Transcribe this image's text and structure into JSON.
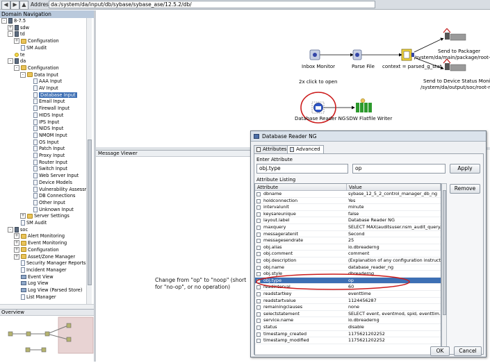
{
  "toolbar": {
    "back": "◀",
    "forward": "◀",
    "up": "▲",
    "address_label": "Address:",
    "address_value": "da:/system/da/input/db/sybase/sybase_ase/12.5.2/db/"
  },
  "domain_nav": {
    "header": "Domain Navigation",
    "items": [
      {
        "label": "8-7.5",
        "indent": 0,
        "tw": "-",
        "icon": "server"
      },
      {
        "label": "sdw",
        "indent": 1,
        "tw": "+",
        "icon": "server"
      },
      {
        "label": "td",
        "indent": 1,
        "tw": "-",
        "icon": "server"
      },
      {
        "label": "Configuration",
        "indent": 2,
        "tw": "+",
        "icon": "folder"
      },
      {
        "label": "SM Audit",
        "indent": 2,
        "tw": "",
        "icon": "doc"
      },
      {
        "label": "te",
        "indent": 1,
        "tw": "",
        "icon": "bulb"
      },
      {
        "label": "da",
        "indent": 1,
        "tw": "-",
        "icon": "server"
      },
      {
        "label": "Configuration",
        "indent": 2,
        "tw": "-",
        "icon": "folder"
      },
      {
        "label": "Data Input",
        "indent": 3,
        "tw": "-",
        "icon": "folder"
      },
      {
        "label": "AAA Input",
        "indent": 4,
        "tw": "",
        "icon": "doc"
      },
      {
        "label": "AV Input",
        "indent": 4,
        "tw": "",
        "icon": "doc"
      },
      {
        "label": "Database Input",
        "indent": 4,
        "tw": "",
        "icon": "doc",
        "selected": true
      },
      {
        "label": "Email Input",
        "indent": 4,
        "tw": "",
        "icon": "doc"
      },
      {
        "label": "Firewall Input",
        "indent": 4,
        "tw": "",
        "icon": "doc"
      },
      {
        "label": "HIDS Input",
        "indent": 4,
        "tw": "",
        "icon": "doc"
      },
      {
        "label": "IPS Input",
        "indent": 4,
        "tw": "",
        "icon": "doc"
      },
      {
        "label": "NIDS Input",
        "indent": 4,
        "tw": "",
        "icon": "doc"
      },
      {
        "label": "NMOM Input",
        "indent": 4,
        "tw": "",
        "icon": "doc"
      },
      {
        "label": "OS Input",
        "indent": 4,
        "tw": "",
        "icon": "doc"
      },
      {
        "label": "Patch Input",
        "indent": 4,
        "tw": "",
        "icon": "doc"
      },
      {
        "label": "Proxy Input",
        "indent": 4,
        "tw": "",
        "icon": "doc"
      },
      {
        "label": "Router Input",
        "indent": 4,
        "tw": "",
        "icon": "doc"
      },
      {
        "label": "Switch Input",
        "indent": 4,
        "tw": "",
        "icon": "doc"
      },
      {
        "label": "Web Server Input",
        "indent": 4,
        "tw": "",
        "icon": "doc"
      },
      {
        "label": "Device Models",
        "indent": 4,
        "tw": "",
        "icon": "doc"
      },
      {
        "label": "Vulnerability Assessmen",
        "indent": 4,
        "tw": "",
        "icon": "doc"
      },
      {
        "label": "DB Connections",
        "indent": 4,
        "tw": "",
        "icon": "doc"
      },
      {
        "label": "Other Input",
        "indent": 4,
        "tw": "",
        "icon": "doc"
      },
      {
        "label": "Unknown Input",
        "indent": 4,
        "tw": "",
        "icon": "doc"
      },
      {
        "label": "Server Settings",
        "indent": 3,
        "tw": "+",
        "icon": "folder"
      },
      {
        "label": "SM Audit",
        "indent": 2,
        "tw": "",
        "icon": "doc"
      },
      {
        "label": "soc",
        "indent": 1,
        "tw": "-",
        "icon": "server"
      },
      {
        "label": "Alert Monitoring",
        "indent": 2,
        "tw": "+",
        "icon": "folder"
      },
      {
        "label": "Event Monitoring",
        "indent": 2,
        "tw": "+",
        "icon": "folder"
      },
      {
        "label": "Configuration",
        "indent": 2,
        "tw": "+",
        "icon": "folder"
      },
      {
        "label": "Asset/Zone Manager",
        "indent": 2,
        "tw": "+",
        "icon": "folder"
      },
      {
        "label": "Security Manager Reports",
        "indent": 2,
        "tw": "",
        "icon": "doc"
      },
      {
        "label": "Incident Manager",
        "indent": 2,
        "tw": "",
        "icon": "doc"
      },
      {
        "label": "Event View",
        "indent": 2,
        "tw": "",
        "icon": "mon"
      },
      {
        "label": "Log View",
        "indent": 2,
        "tw": "",
        "icon": "mon"
      },
      {
        "label": "Log View (Parsed Store)",
        "indent": 2,
        "tw": "",
        "icon": "mon"
      },
      {
        "label": "List Manager",
        "indent": 2,
        "tw": "",
        "icon": "doc"
      }
    ]
  },
  "overview": {
    "header": "Overview"
  },
  "canvas": {
    "inbox_monitor": "Inbox Monitor",
    "parse_file": "Parse File",
    "context_label": "context = parsed_g_stat",
    "send_packager": "Send to Packager",
    "send_packager_path": "/system/da/main/package/root-n",
    "send_status_monitor": "Send to Device Status Monito",
    "send_status_monitor_path": "/system/da/output/soc/root-noc",
    "hint": "2x click to open",
    "db_reader": "Database Reader NG",
    "sdw_writer": "SDW Flatfile Writer"
  },
  "message_viewer": {
    "header": "Message Viewer"
  },
  "dialog": {
    "title": "Database Reader NG",
    "tabs": [
      {
        "label": "Attributes"
      },
      {
        "label": "Advanced"
      }
    ],
    "enter_attribute_label": "Enter Attribute",
    "attr_name_value": "obj.type",
    "attr_value_value": "op",
    "apply_label": "Apply",
    "remove_label": "Remove",
    "listing_label": "Attribute Listing",
    "col_attribute": "Attribute",
    "col_value": "Value",
    "rows": [
      {
        "name": "dbname",
        "value": "sybase_12_5_2_control_manager_db_ng"
      },
      {
        "name": "holdconnection",
        "value": "Yes"
      },
      {
        "name": "intervalunit",
        "value": "minute"
      },
      {
        "name": "keysareunique",
        "value": "false"
      },
      {
        "name": "layout.label",
        "value": "Database Reader NG"
      },
      {
        "name": "maxquery",
        "value": "SELECT MAX(auditsuser.nsm_audit_query..."
      },
      {
        "name": "messageratenit",
        "value": "Second"
      },
      {
        "name": "messagesendrate",
        "value": "25"
      },
      {
        "name": "obj.alias",
        "value": "io.dbreaderng"
      },
      {
        "name": "obj.comment",
        "value": "comment"
      },
      {
        "name": "obj.description",
        "value": "(Explanation of any configuration instructi..."
      },
      {
        "name": "obj.name",
        "value": "database_reader_ng"
      },
      {
        "name": "obj.style",
        "value": "dbreaderng"
      },
      {
        "name": "obj.type",
        "value": "op",
        "selected": true
      },
      {
        "name": "readinterval",
        "value": "60"
      },
      {
        "name": "readstartkey",
        "value": "eventtime"
      },
      {
        "name": "readstartvalue",
        "value": "1124456287"
      },
      {
        "name": "remainingclauses",
        "value": "none"
      },
      {
        "name": "selectstatement",
        "value": "SELECT event, eventmod, spid, eventtim..."
      },
      {
        "name": "service.name",
        "value": "io.dbreaderng"
      },
      {
        "name": "status",
        "value": "disable"
      },
      {
        "name": "timestamp_created",
        "value": "1175621202252"
      },
      {
        "name": "timestamp_modified",
        "value": "1175621202252"
      }
    ],
    "ok_label": "OK",
    "cancel_label": "Cancel"
  },
  "annotation": {
    "note": "Change from \"op\" to \"noop\" (short for \"no-op\", or no operation)"
  },
  "colors": {
    "highlight": "#cc1b1b",
    "selection": "#3d6fb4",
    "green_node": "#2d9a2d"
  }
}
